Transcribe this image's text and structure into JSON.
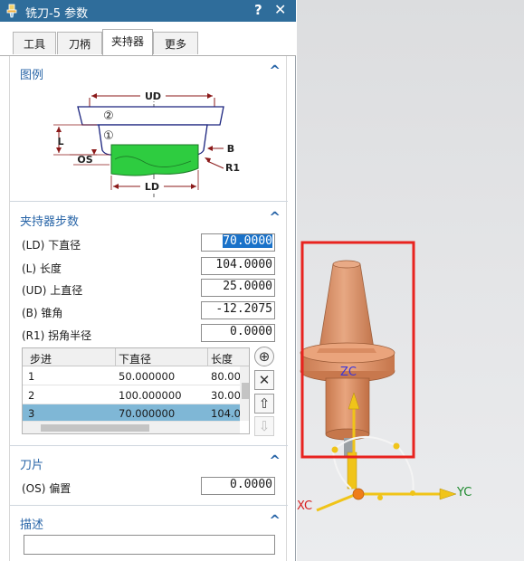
{
  "dialog": {
    "title": "铣刀-5 参数",
    "help": "?",
    "close": "✕"
  },
  "tabs": [
    {
      "label": "工具"
    },
    {
      "label": "刀柄"
    },
    {
      "label": "夹持器",
      "active": true
    },
    {
      "label": "更多"
    }
  ],
  "legend": {
    "header": "图例",
    "diagram_labels": {
      "ud": "UD",
      "l": "L",
      "os": "OS",
      "b": "B",
      "r1": "R1",
      "ld": "LD",
      "step1": "①",
      "step2": "②"
    }
  },
  "holder_steps": {
    "header": "夹持器步数",
    "params": [
      {
        "label": "(LD) 下直径",
        "value": "70.0000",
        "selected": true
      },
      {
        "label": "(L) 长度",
        "value": "104.0000"
      },
      {
        "label": "(UD) 上直径",
        "value": "25.0000"
      },
      {
        "label": "(B) 锥角",
        "value": "-12.2075"
      },
      {
        "label": "(R1) 拐角半径",
        "value": "0.0000"
      }
    ],
    "table": {
      "columns": [
        "步进",
        "下直径",
        "长度"
      ],
      "rows": [
        [
          "1",
          "50.000000",
          "80.00"
        ],
        [
          "2",
          "100.000000",
          "30.00"
        ],
        [
          "3",
          "70.000000",
          "104.0"
        ]
      ],
      "selected_row": 3
    },
    "buttons": [
      "add-icon",
      "delete-icon",
      "move-up-icon",
      "move-down-icon"
    ]
  },
  "blade": {
    "header": "刀片",
    "params": [
      {
        "label": "(OS) 偏置",
        "value": "0.0000"
      }
    ]
  },
  "description": {
    "header": "描述",
    "value": ""
  },
  "viewport": {
    "axes": {
      "zc": "ZC",
      "yc": "YC",
      "xc": "XC"
    },
    "colors": {
      "holder": "#e0976b",
      "axis": "#f0c419",
      "highlight": "#e8231f",
      "titlebar": "#2f6d9b",
      "accent": "#2a66a8"
    }
  }
}
